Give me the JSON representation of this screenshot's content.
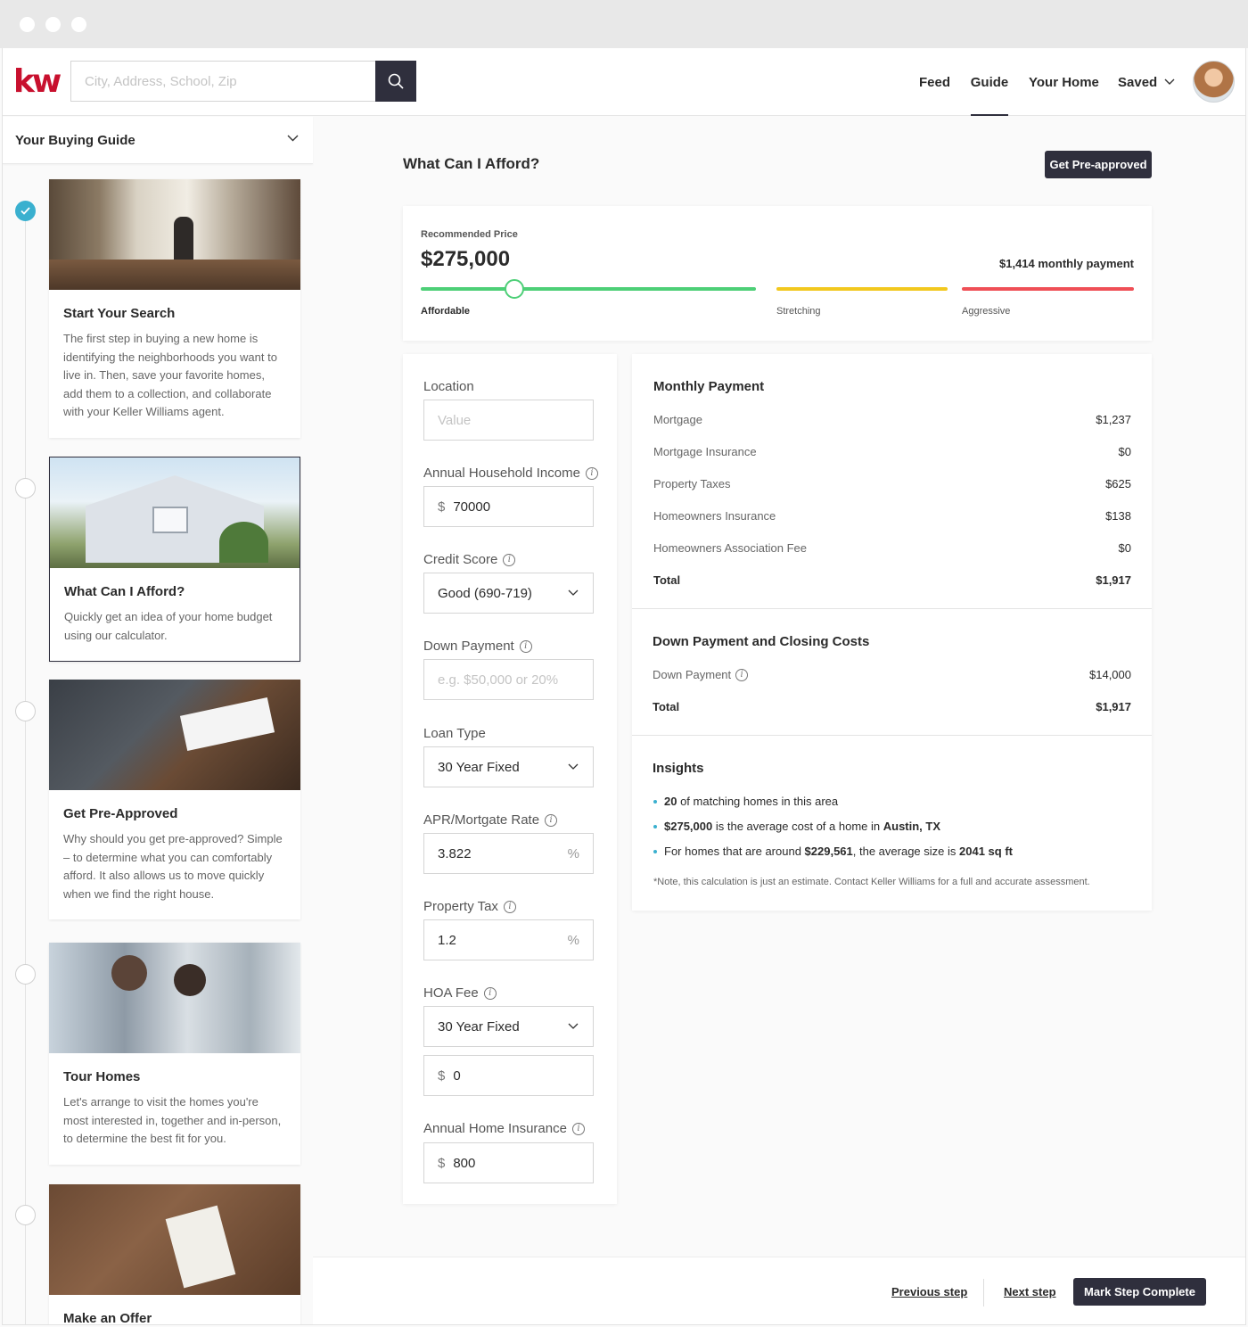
{
  "header": {
    "logo": "kw",
    "search_placeholder": "City, Address, School, Zip",
    "nav": [
      "Feed",
      "Guide",
      "Your Home",
      "Saved"
    ],
    "active_nav": "Guide"
  },
  "sidebar": {
    "title": "Your Buying Guide",
    "steps": [
      {
        "title": "Start Your Search",
        "body": "The first step in buying a new home is identifying the neighborhoods you want to live in. Then, save your favorite homes, add them to a collection, and collaborate with your Keller Williams agent.",
        "completed": true
      },
      {
        "title": "What Can I Afford?",
        "body": "Quickly get an idea of your home budget using our calculator.",
        "completed": false
      },
      {
        "title": "Get Pre-Approved",
        "body": "Why should you get pre-approved? Simple – to determine what you can comfortably afford. It also allows us to move quickly when we find the right house.",
        "completed": false
      },
      {
        "title": "Tour Homes",
        "body": "Let's arrange to visit the homes you're most interested in, together and in-person, to determine the best fit for you.",
        "completed": false
      },
      {
        "title": "Make an Offer",
        "body": "",
        "completed": false
      }
    ]
  },
  "main": {
    "title": "What Can I Afford?",
    "preapproved_button": "Get Pre-approved",
    "recommendation": {
      "label": "Recommended Price",
      "price": "$275,000",
      "monthly": "$1,414 monthly payment",
      "zones": [
        "Affordable",
        "Stretching",
        "Aggressive"
      ],
      "slider_fraction": 0.28,
      "colors": {
        "affordable": "#4dcf77",
        "stretching": "#f2c81e",
        "aggressive": "#ef4f56"
      }
    },
    "form": {
      "location_label": "Location",
      "location_placeholder": "Value",
      "income_label": "Annual Household Income",
      "income_prefix": "$",
      "income_value": "70000",
      "credit_label": "Credit Score",
      "credit_value": "Good (690-719)",
      "down_label": "Down Payment",
      "down_placeholder": "e.g.  $50,000 or 20%",
      "loan_label": "Loan Type",
      "loan_value": "30 Year Fixed",
      "apr_label": "APR/Mortgate Rate",
      "apr_value": "3.822",
      "percent": "%",
      "tax_label": "Property Tax",
      "tax_value": "1.2",
      "hoa_label": "HOA Fee",
      "hoa_value": "30 Year Fixed",
      "hoa_prefix": "$",
      "hoa_amount": "0",
      "insurance_label": "Annual Home Insurance",
      "insurance_prefix": "$",
      "insurance_value": "800"
    },
    "monthly": {
      "title": "Monthly Payment",
      "rows": [
        {
          "label": "Mortgage",
          "value": "$1,237"
        },
        {
          "label": "Mortgage Insurance",
          "value": "$0"
        },
        {
          "label": "Property Taxes",
          "value": "$625"
        },
        {
          "label": "Homeowners Insurance",
          "value": "$138"
        },
        {
          "label": "Homeowners Association Fee",
          "value": "$0"
        }
      ],
      "total_label": "Total",
      "total_value": "$1,917"
    },
    "closing": {
      "title": "Down Payment and Closing Costs",
      "down_label": "Down Payment",
      "down_value": "$14,000",
      "total_label": "Total",
      "total_value": "$1,917"
    },
    "insights": {
      "title": "Insights",
      "i1_num": "20",
      "i1_text": " of matching homes in this area",
      "i2_price": "$275,000",
      "i2_text": " is the average cost of a home in ",
      "i2_city": "Austin, TX",
      "i3_pre": "For homes that are around ",
      "i3_price": "$229,561",
      "i3_mid": ", the average size is ",
      "i3_size": "2041 sq ft",
      "note": "*Note, this calculation is just an estimate. Contact Keller Williams for a full and accurate assessment."
    }
  },
  "footer": {
    "previous": "Previous step",
    "next": "Next step",
    "complete": "Mark Step Complete"
  }
}
